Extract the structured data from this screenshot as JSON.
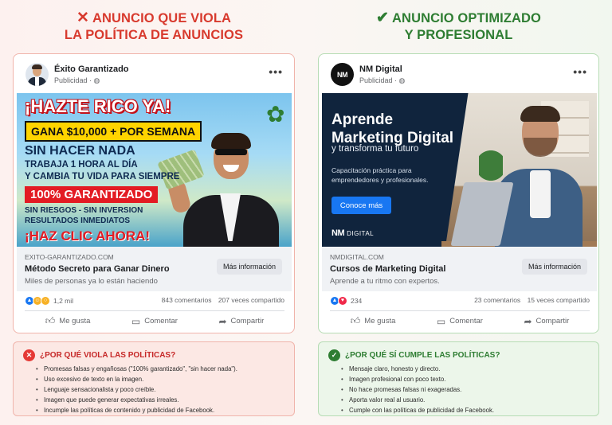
{
  "left": {
    "heading_line1": "ANUNCIO QUE VIOLA",
    "heading_line2": "LA POLÍTICA DE ANUNCIOS",
    "heading_icon": "x-mark-icon",
    "post": {
      "page_name": "Éxito Garantizado",
      "sponsored": "Publicidad · ",
      "creative_lines": [
        "¡HAZTE RICO YA!",
        "GANA $10,000 + POR SEMANA",
        "SIN HACER NADA",
        "TRABAJA 1 HORA AL DÍA",
        "Y CAMBIA TU VIDA PARA SIEMPRE",
        "100% GARANTIZADO",
        "SIN RIESGOS - SIN INVERSION",
        "RESULTADOS INMEDIATOS",
        "¡HAZ CLIC AHORA!"
      ],
      "link_domain": "EXITO-GARANTIZADO.COM",
      "link_title": "Método Secreto para Ganar Dinero",
      "link_desc": "Miles de personas ya lo están haciendo",
      "cta": "Más información",
      "reaction_count": "1,2 mil",
      "comments": "843 comentarios",
      "shares": "207 veces compartido",
      "actions": [
        "Me gusta",
        "Comentar",
        "Compartir"
      ]
    },
    "reasons_title": "¿POR QUÉ VIOLA LAS POLÍTICAS?",
    "reasons": [
      "Promesas falsas y engañosas (\"100% garantizado\", \"sin hacer nada\").",
      "Uso excesivo de texto en la imagen.",
      "Lenguaje sensacionalista y poco creíble.",
      "Imagen que puede generar expectativas irreales.",
      "Incumple las políticas de contenido y publicidad de Facebook."
    ]
  },
  "right": {
    "heading_line1": "ANUNCIO OPTIMIZADO",
    "heading_line2": "Y PROFESIONAL",
    "heading_icon": "check-mark-icon",
    "post": {
      "page_name": "NM Digital",
      "sponsored": "Publicidad · ",
      "avatar_text": "NM",
      "creative_title_1": "Aprende",
      "creative_title_2": "Marketing Digital",
      "creative_sub": "y transforma tu futuro",
      "creative_desc": "Capacitación práctica para emprendedores y profesionales.",
      "creative_cta": "Conoce más",
      "creative_logo_mark": "NM",
      "creative_logo_text": "DIGITAL",
      "link_domain": "NMDIGITAL.COM",
      "link_title": "Cursos de Marketing Digital",
      "link_desc": "Aprende a tu ritmo con expertos.",
      "cta": "Más información",
      "reaction_count": "234",
      "comments": "23 comentarios",
      "shares": "15 veces compartido",
      "actions": [
        "Me gusta",
        "Comentar",
        "Compartir"
      ]
    },
    "reasons_title": "¿POR QUÉ SÍ CUMPLE LAS POLÍTICAS?",
    "reasons": [
      "Mensaje claro, honesto y directo.",
      "Imagen profesional con poco texto.",
      "No hace promesas falsas ni exageradas.",
      "Aporta valor real al usuario.",
      "Cumple con las políticas de publicidad de Facebook."
    ]
  },
  "colors": {
    "bad": "#d83a2e",
    "good": "#2e7d32",
    "facebook_blue": "#1877f2"
  }
}
